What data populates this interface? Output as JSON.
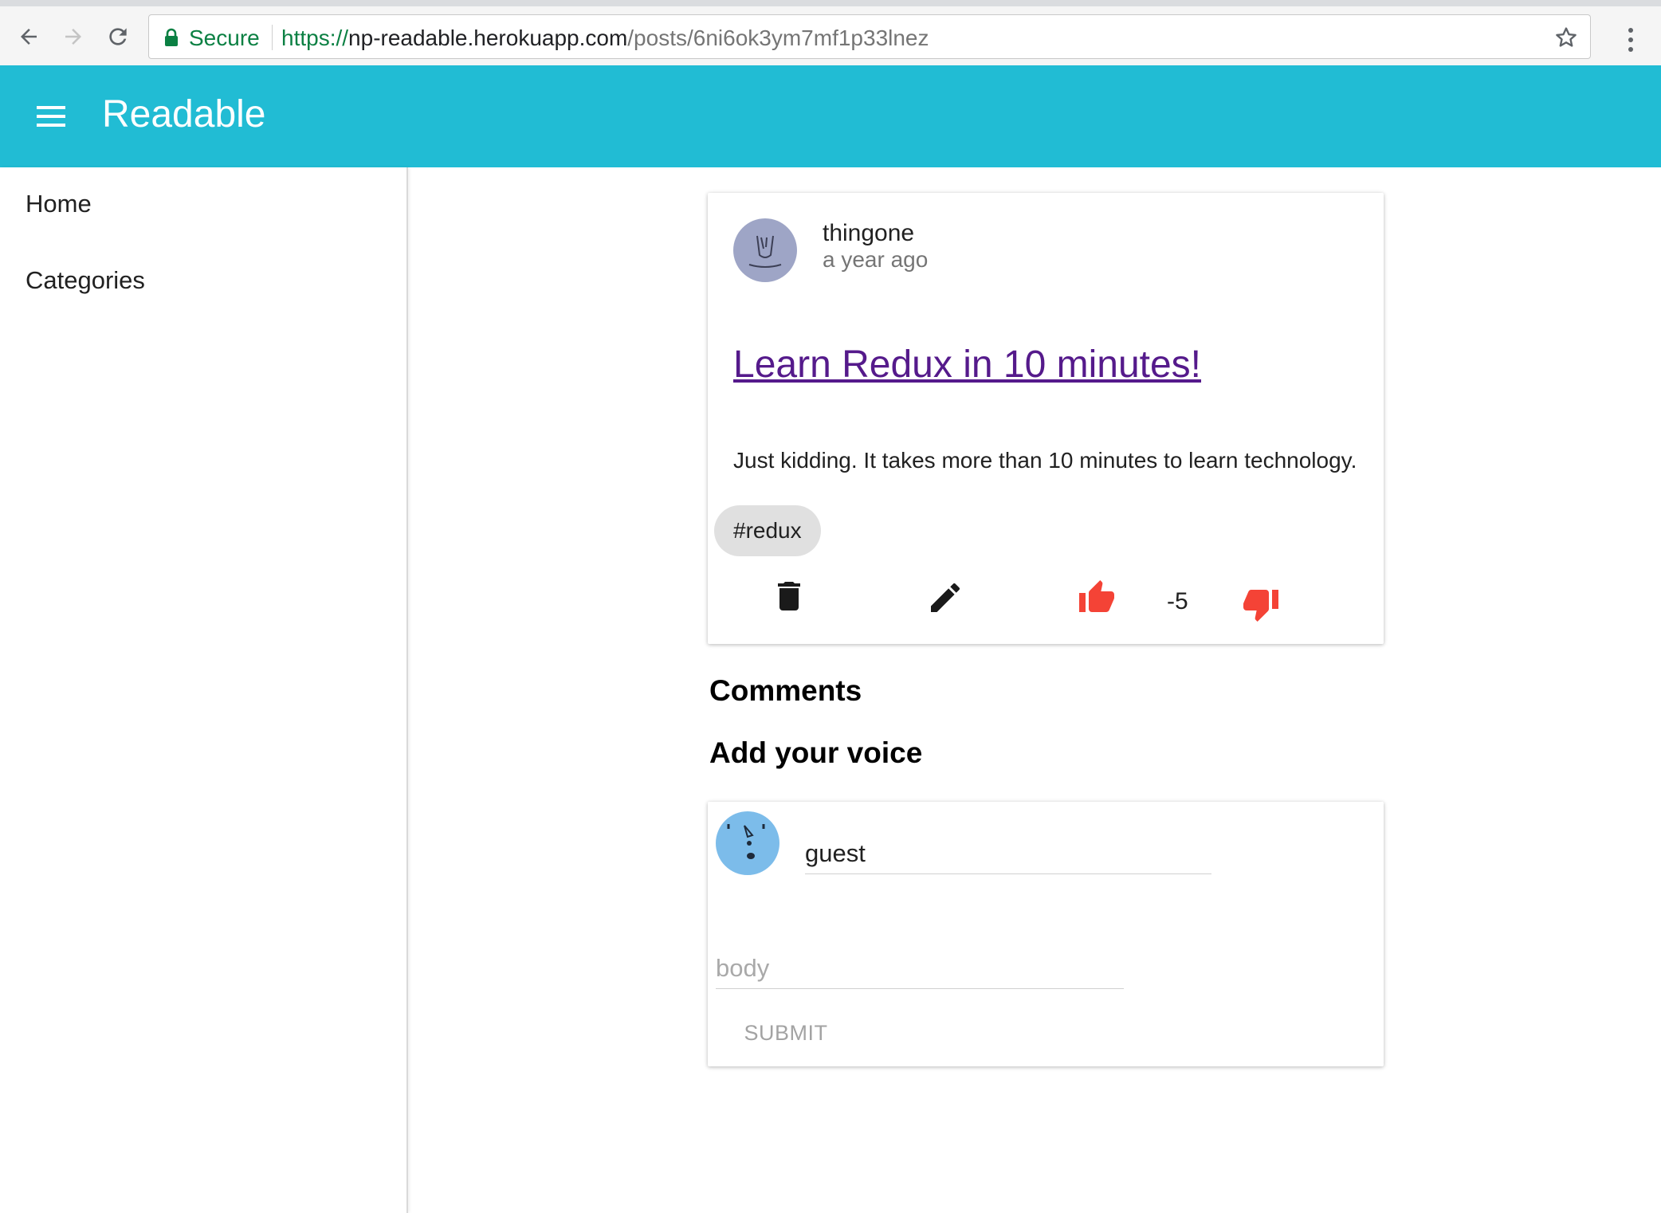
{
  "browser": {
    "secure_label": "Secure",
    "url_scheme": "https://",
    "url_host": "np-readable.herokuapp.com",
    "url_path": "/posts/6ni6ok3ym7mf1p33lnez"
  },
  "appbar": {
    "title": "Readable"
  },
  "drawer": {
    "items": [
      {
        "label": "Home"
      },
      {
        "label": "Categories"
      }
    ]
  },
  "post": {
    "author": "thingone",
    "time": "a year ago",
    "title": "Learn Redux in 10 minutes!",
    "body": "Just kidding. It takes more than 10 minutes to learn technology.",
    "category_chip": "#redux",
    "vote_score": "-5",
    "colors": {
      "title_link": "#551a8b",
      "vote_icons": "#f44336"
    },
    "icons": [
      "delete-icon",
      "edit-icon",
      "thumb-up-icon",
      "thumb-down-icon"
    ]
  },
  "comments": {
    "heading": "Comments"
  },
  "add_comment": {
    "heading": "Add your voice",
    "author_value": "guest",
    "body_placeholder": "body",
    "submit_label": "SUBMIT"
  },
  "theme": {
    "appbar_color": "#21bcd4",
    "secure_color": "#0b8043"
  }
}
